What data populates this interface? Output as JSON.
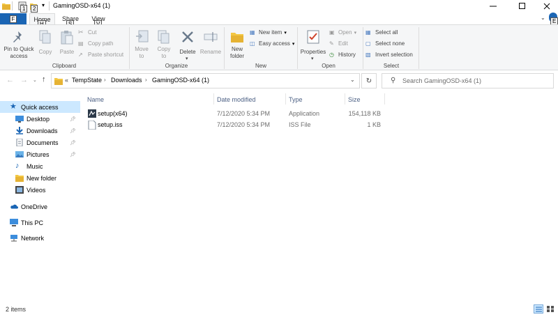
{
  "window": {
    "title": "GamingOSD-x64 (1)"
  },
  "keytips": {
    "qa1": "1",
    "qa2": "2",
    "file": "F",
    "home": "H",
    "share": "S",
    "view": "V",
    "help": "E"
  },
  "tabs": {
    "file": "File",
    "home": "Home",
    "share": "Share",
    "view": "View"
  },
  "ribbon": {
    "clipboard": {
      "group_label": "Clipboard",
      "pin_label_1": "Pin to Quick",
      "pin_label_2": "access",
      "copy": "Copy",
      "paste": "Paste",
      "cut": "Cut",
      "copy_path": "Copy path",
      "paste_shortcut": "Paste shortcut"
    },
    "organize": {
      "group_label": "Organize",
      "move_to_1": "Move",
      "move_to_2": "to",
      "copy_to_1": "Copy",
      "copy_to_2": "to",
      "delete": "Delete",
      "rename": "Rename"
    },
    "new": {
      "group_label": "New",
      "new_folder_1": "New",
      "new_folder_2": "folder",
      "new_item": "New item",
      "easy_access": "Easy access"
    },
    "open": {
      "group_label": "Open",
      "properties": "Properties",
      "open": "Open",
      "edit": "Edit",
      "history": "History"
    },
    "select": {
      "group_label": "Select",
      "select_all": "Select all",
      "select_none": "Select none",
      "invert_selection": "Invert selection"
    }
  },
  "address": {
    "prefix": "«",
    "crumbs": [
      "TempState",
      "Downloads",
      "GamingOSD-x64 (1)"
    ]
  },
  "search": {
    "placeholder": "Search GamingOSD-x64 (1)"
  },
  "sidebar": {
    "quick_access": "Quick access",
    "items": [
      {
        "label": "Desktop",
        "icon": "desktop-icon",
        "pinned": true
      },
      {
        "label": "Downloads",
        "icon": "download-icon",
        "pinned": true
      },
      {
        "label": "Documents",
        "icon": "document-icon",
        "pinned": true
      },
      {
        "label": "Pictures",
        "icon": "pictures-icon",
        "pinned": true
      },
      {
        "label": "Music",
        "icon": "music-icon",
        "pinned": false
      },
      {
        "label": "New folder",
        "icon": "folder-icon",
        "pinned": false
      },
      {
        "label": "Videos",
        "icon": "video-icon",
        "pinned": false
      }
    ],
    "onedrive": "OneDrive",
    "this_pc": "This PC",
    "network": "Network"
  },
  "columns": {
    "name": "Name",
    "date": "Date modified",
    "type": "Type",
    "size": "Size"
  },
  "files": [
    {
      "name": "setup(x64)",
      "date": "7/12/2020 5:34 PM",
      "type": "Application",
      "size": "154,118 KB",
      "icon": "application-icon"
    },
    {
      "name": "setup.iss",
      "date": "7/12/2020 5:34 PM",
      "type": "ISS File",
      "size": "1 KB",
      "icon": "file-icon"
    }
  ],
  "status": {
    "item_count": "2 items"
  },
  "colors": {
    "accent": "#1a65b4",
    "folder": "#f3c743",
    "header_text": "#4d6185"
  }
}
